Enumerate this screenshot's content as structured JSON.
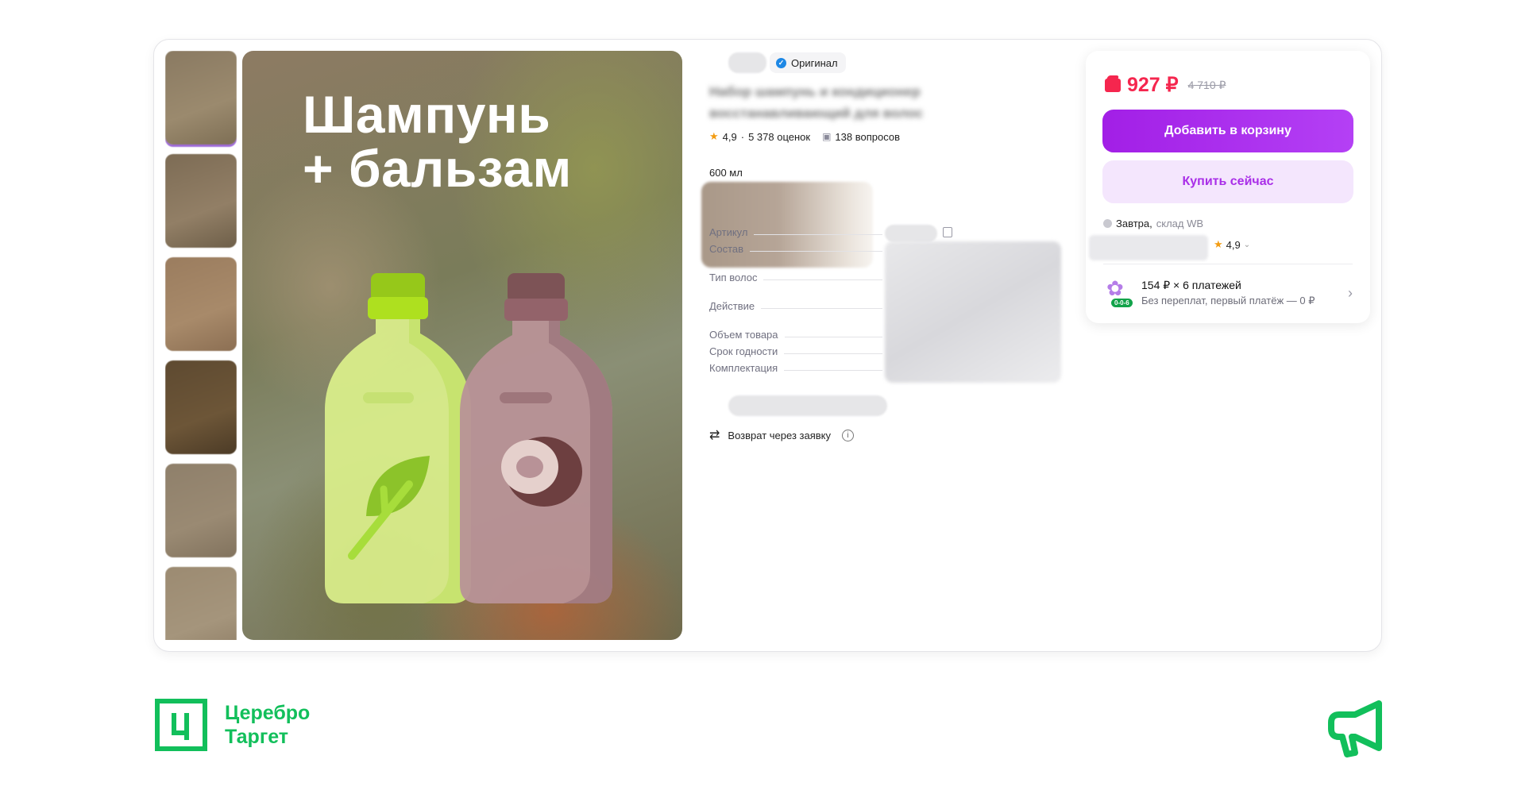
{
  "hero": {
    "title_line1": "Шампунь",
    "title_line2": "+ бальзам"
  },
  "badge": {
    "original": "Оригинал"
  },
  "product": {
    "title_blurred": "Набор шампунь и кондиционер восстанавливающий для волос",
    "rating": "4,9",
    "reviews": "5 378 оценок",
    "questions": "138 вопросов",
    "volume": "600 мл"
  },
  "specs": [
    {
      "label": "Артикул"
    },
    {
      "label": "Состав"
    },
    {
      "label": "Тип волос"
    },
    {
      "label": "Действие"
    },
    {
      "label": "Объем товара"
    },
    {
      "label": "Срок годности"
    },
    {
      "label": "Комплектация"
    }
  ],
  "return_text": "Возврат через заявку",
  "buy_panel": {
    "price": "927 ₽",
    "old_price": "4 710 ₽",
    "add_to_cart": "Добавить в корзину",
    "buy_now": "Купить сейчас",
    "delivery_day": "Завтра,",
    "delivery_warehouse": "склад WB",
    "seller_rating": "4,9",
    "installment_title": "154 ₽ × 6 платежей",
    "installment_sub": "Без переплат, первый платёж — 0 ₽",
    "installment_badge": "0-0-6"
  },
  "brand": {
    "line1": "Церебро",
    "line2": "Таргет"
  },
  "colors": {
    "accent_purple": "#a21fe6",
    "price_red": "#f5264e",
    "brand_green": "#12bf5b"
  },
  "icons": [
    "verified-check-icon",
    "star-icon",
    "question-icon",
    "copy-icon",
    "return-arrows-icon",
    "info-icon",
    "wallet-icon",
    "clover-icon",
    "chevron-right-icon",
    "megaphone-icon"
  ]
}
